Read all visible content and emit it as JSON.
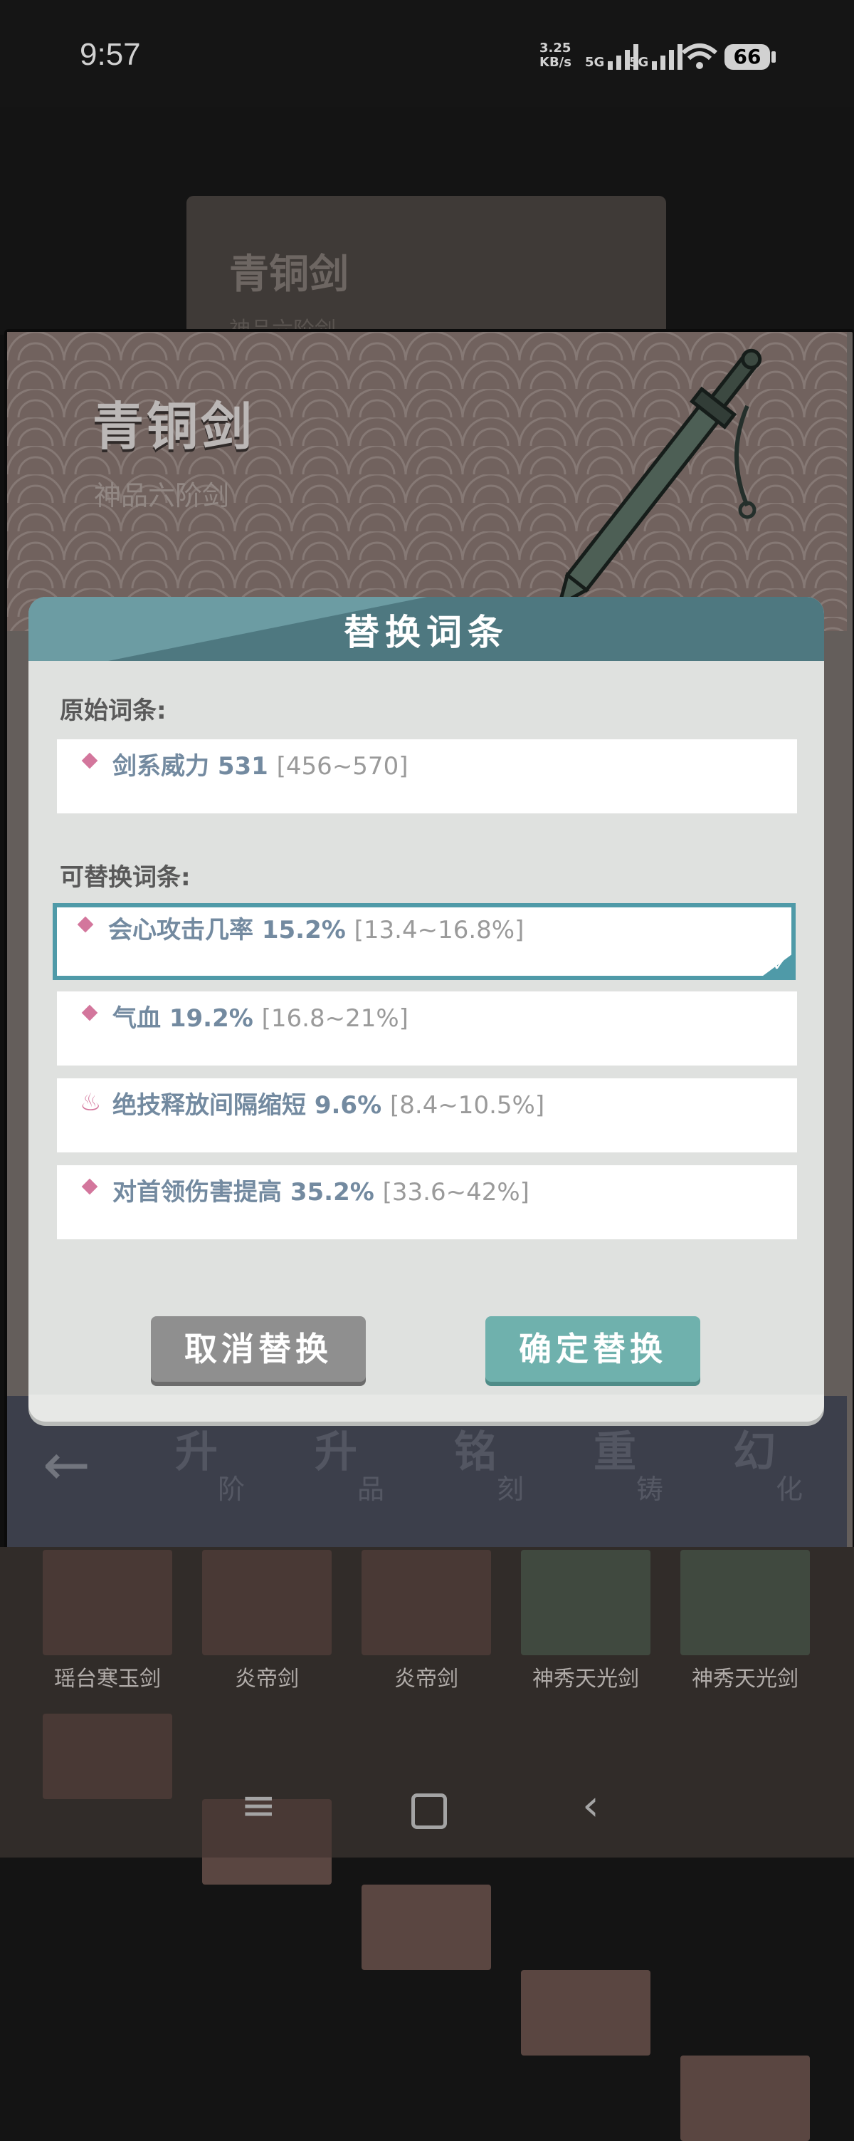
{
  "status_bar": {
    "time": "9:57",
    "net_speed_top": "3.25",
    "net_speed_unit": "KB/s",
    "sim1": "5G",
    "sim2": "5G",
    "battery": "66"
  },
  "background_card": {
    "title": "青铜剑",
    "subtitle": "神品六阶剑"
  },
  "header": {
    "weapon_name": "青铜剑",
    "weapon_grade": "神品六阶剑"
  },
  "dialog": {
    "title": "替换词条",
    "original_label": "原始词条:",
    "original_entry": {
      "icon": "diamond-icon",
      "text": "剑系威力 531",
      "range": "[456~570]"
    },
    "replaceable_label": "可替换词条:",
    "options": [
      {
        "icon": "diamond-icon",
        "text": "会心攻击几率 15.2%",
        "range": "[13.4~16.8%]",
        "selected": true
      },
      {
        "icon": "diamond-icon",
        "text": "气血 19.2%",
        "range": "[16.8~21%]",
        "selected": false
      },
      {
        "icon": "flame-icon",
        "text": "绝技释放间隔缩短 9.6%",
        "range": "[8.4~10.5%]",
        "selected": false
      },
      {
        "icon": "diamond-icon",
        "text": "对首领伤害提高 35.2%",
        "range": "[33.6~42%]",
        "selected": false
      }
    ],
    "cancel_label": "取消替换",
    "confirm_label": "确定替换"
  },
  "toolbar": {
    "back_icon": "arrow-left-icon",
    "items": [
      {
        "big": "升",
        "small": "阶"
      },
      {
        "big": "升",
        "small": "品"
      },
      {
        "big": "铭",
        "small": "刻"
      },
      {
        "big": "重",
        "small": "铸"
      },
      {
        "big": "幻",
        "small": "化"
      }
    ]
  },
  "weapons": [
    "瑶台寒玉剑",
    "炎帝剑",
    "炎帝剑",
    "神秀天光剑",
    "神秀天光剑"
  ],
  "colors": {
    "dialog_header": "#4e7880",
    "selected_border": "#4f9aa8",
    "confirm_button": "#6fb1ad",
    "cancel_button": "#8f8f8f",
    "diamond": "#d3769c"
  }
}
